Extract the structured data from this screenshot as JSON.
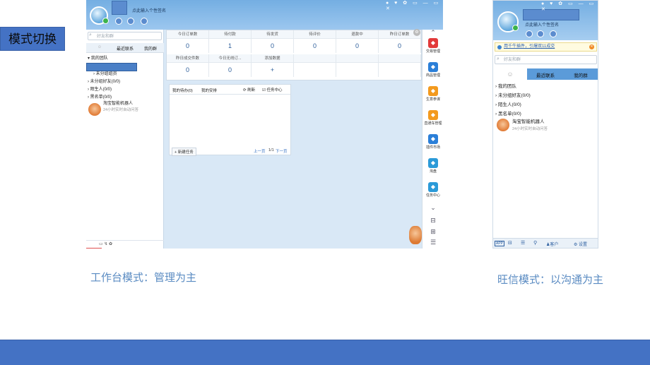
{
  "slide": {
    "badge": "模式切换",
    "left_caption": "工作台模式：管理为主",
    "right_caption": "旺信模式：以沟通为主",
    "accent": "#4472c4"
  },
  "workbench": {
    "signature": "点此输入个性签名",
    "search_placeholder": "好友和群",
    "tabs": [
      "最近联系",
      "我的群"
    ],
    "tree": {
      "team": "我的团队",
      "ungrouped_members": "未分组组员",
      "ungrouped_friends": "未分组好友(0/0)",
      "strangers": "陌生人(0/0)",
      "blacklist": "黑名单(0/0)",
      "robot_name": "淘宝智能机器人",
      "robot_desc": "24小时实时自动问答"
    },
    "stats": {
      "headers1": [
        "今日订单数",
        "待付款",
        "待发货",
        "待评价",
        "退款中",
        "昨日订单数"
      ],
      "values1": [
        "0",
        "1",
        "0",
        "0",
        "0",
        "0"
      ],
      "headers2": [
        "昨日成交件数",
        "今日无线订...",
        "添加数据"
      ],
      "values2": [
        "0",
        "0",
        "+"
      ]
    },
    "tasks": {
      "tab_mine": "我的待办(0)",
      "tab_assigned": "我的安排",
      "refresh": "刷新",
      "center": "任务中心",
      "new_task": "+ 新建任务",
      "prev": "上一页",
      "page": "1/1",
      "next": "下一页"
    },
    "rail": [
      {
        "label": "交易管理",
        "icon": "trade-icon",
        "color": "#e23a3a"
      },
      {
        "label": "商品管理",
        "icon": "goods-icon",
        "color": "#2b7fd8"
      },
      {
        "label": "生意参谋",
        "icon": "advisor-icon",
        "color": "#f39a1e"
      },
      {
        "label": "直通车管理",
        "icon": "car-icon",
        "color": "#f39a1e"
      },
      {
        "label": "插件市场",
        "icon": "plugin-icon",
        "color": "#2b7fd8"
      },
      {
        "label": "淘盘",
        "icon": "cloud-icon",
        "color": "#2b9ad8"
      },
      {
        "label": "任务中心",
        "icon": "task-icon",
        "color": "#2b9ad8"
      }
    ]
  },
  "wangxin": {
    "signature": "点此输入个性签名",
    "notice": "用千牛插件，引爆双11成交",
    "search_placeholder": "好友和群",
    "tabs": [
      "最近联系",
      "我的群"
    ],
    "tree": {
      "team": "我的团队",
      "ungrouped_friends": "未分组好友(0/0)",
      "strangers": "陌生人(0/0)",
      "blacklist": "黑名单(0/0)",
      "robot_name": "淘宝智能机器人",
      "robot_desc": "24小时实时自动问答"
    },
    "bottom": {
      "app": "APP",
      "customer": "客户",
      "settings": "设置"
    }
  }
}
